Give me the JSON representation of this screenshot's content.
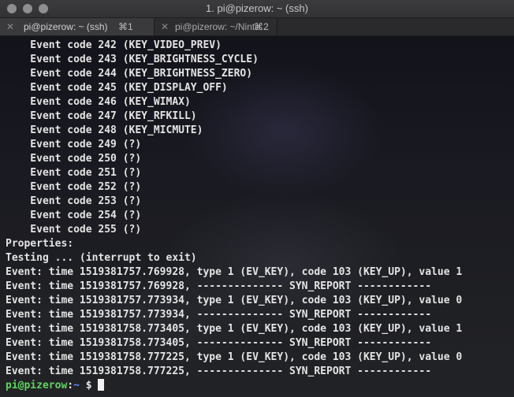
{
  "window": {
    "title": "1. pi@pizerow: ~ (ssh)"
  },
  "tabs": [
    {
      "close_icon": "✕",
      "label": "pi@pizerow: ~ (ssh)",
      "shortcut": "⌘1",
      "active": true
    },
    {
      "close_icon": "✕",
      "label": "pi@pizerow: ~/Ninte…",
      "shortcut": "⌘2",
      "active": false
    }
  ],
  "terminal": {
    "lines": [
      "    Event code 242 (KEY_VIDEO_PREV)",
      "    Event code 243 (KEY_BRIGHTNESS_CYCLE)",
      "    Event code 244 (KEY_BRIGHTNESS_ZERO)",
      "    Event code 245 (KEY_DISPLAY_OFF)",
      "    Event code 246 (KEY_WIMAX)",
      "    Event code 247 (KEY_RFKILL)",
      "    Event code 248 (KEY_MICMUTE)",
      "    Event code 249 (?)",
      "    Event code 250 (?)",
      "    Event code 251 (?)",
      "    Event code 252 (?)",
      "    Event code 253 (?)",
      "    Event code 254 (?)",
      "    Event code 255 (?)",
      "Properties:",
      "Testing ... (interrupt to exit)",
      "Event: time 1519381757.769928, type 1 (EV_KEY), code 103 (KEY_UP), value 1",
      "Event: time 1519381757.769928, -------------- SYN_REPORT ------------",
      "Event: time 1519381757.773934, type 1 (EV_KEY), code 103 (KEY_UP), value 0",
      "Event: time 1519381757.773934, -------------- SYN_REPORT ------------",
      "Event: time 1519381758.773405, type 1 (EV_KEY), code 103 (KEY_UP), value 1",
      "Event: time 1519381758.773405, -------------- SYN_REPORT ------------",
      "Event: time 1519381758.777225, type 1 (EV_KEY), code 103 (KEY_UP), value 0",
      "Event: time 1519381758.777225, -------------- SYN_REPORT ------------"
    ],
    "prompt": {
      "user_host": "pi@pizerow",
      "separator": ":",
      "path": "~",
      "symbol": " $ "
    }
  },
  "colors": {
    "prompt_user": "#5fd35f",
    "prompt_path": "#6a8cff",
    "text": "#e4e4e4"
  }
}
